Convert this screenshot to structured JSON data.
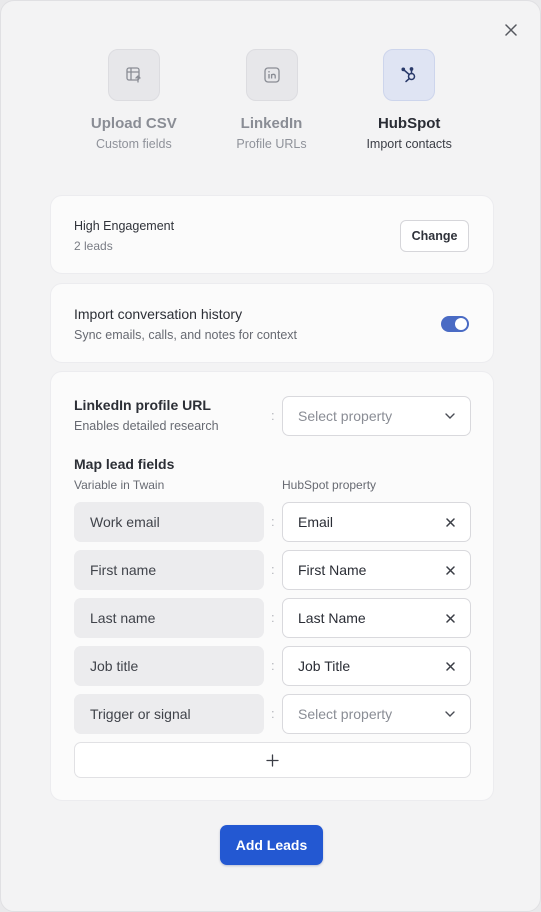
{
  "sources": [
    {
      "title": "Upload CSV",
      "sub": "Custom fields",
      "icon": "csv-table-icon"
    },
    {
      "title": "LinkedIn",
      "sub": "Profile URLs",
      "icon": "linkedin-icon"
    },
    {
      "title": "HubSpot",
      "sub": "Import contacts",
      "icon": "hubspot-icon",
      "active": true
    }
  ],
  "segment": {
    "name": "High Engagement",
    "count": "2 leads",
    "change_label": "Change"
  },
  "history": {
    "title": "Import conversation history",
    "sub": "Sync emails, calls, and notes for context",
    "enabled": true
  },
  "linkedin_field": {
    "title": "LinkedIn profile URL",
    "sub": "Enables detailed research",
    "placeholder": "Select property"
  },
  "mapping": {
    "title": "Map lead fields",
    "col_variable": "Variable in Twain",
    "col_property": "HubSpot property",
    "rows": [
      {
        "variable": "Work email",
        "property": "Email",
        "filled": true
      },
      {
        "variable": "First name",
        "property": "First Name",
        "filled": true
      },
      {
        "variable": "Last name",
        "property": "Last Name",
        "filled": true
      },
      {
        "variable": "Job title",
        "property": "Job Title",
        "filled": true
      },
      {
        "variable": "Trigger or signal",
        "property": "Select property",
        "filled": false
      }
    ],
    "separator": ":"
  },
  "add_button_label": "Add Leads",
  "colors": {
    "accent": "#2358d2",
    "toggle": "#4a6bc4"
  }
}
